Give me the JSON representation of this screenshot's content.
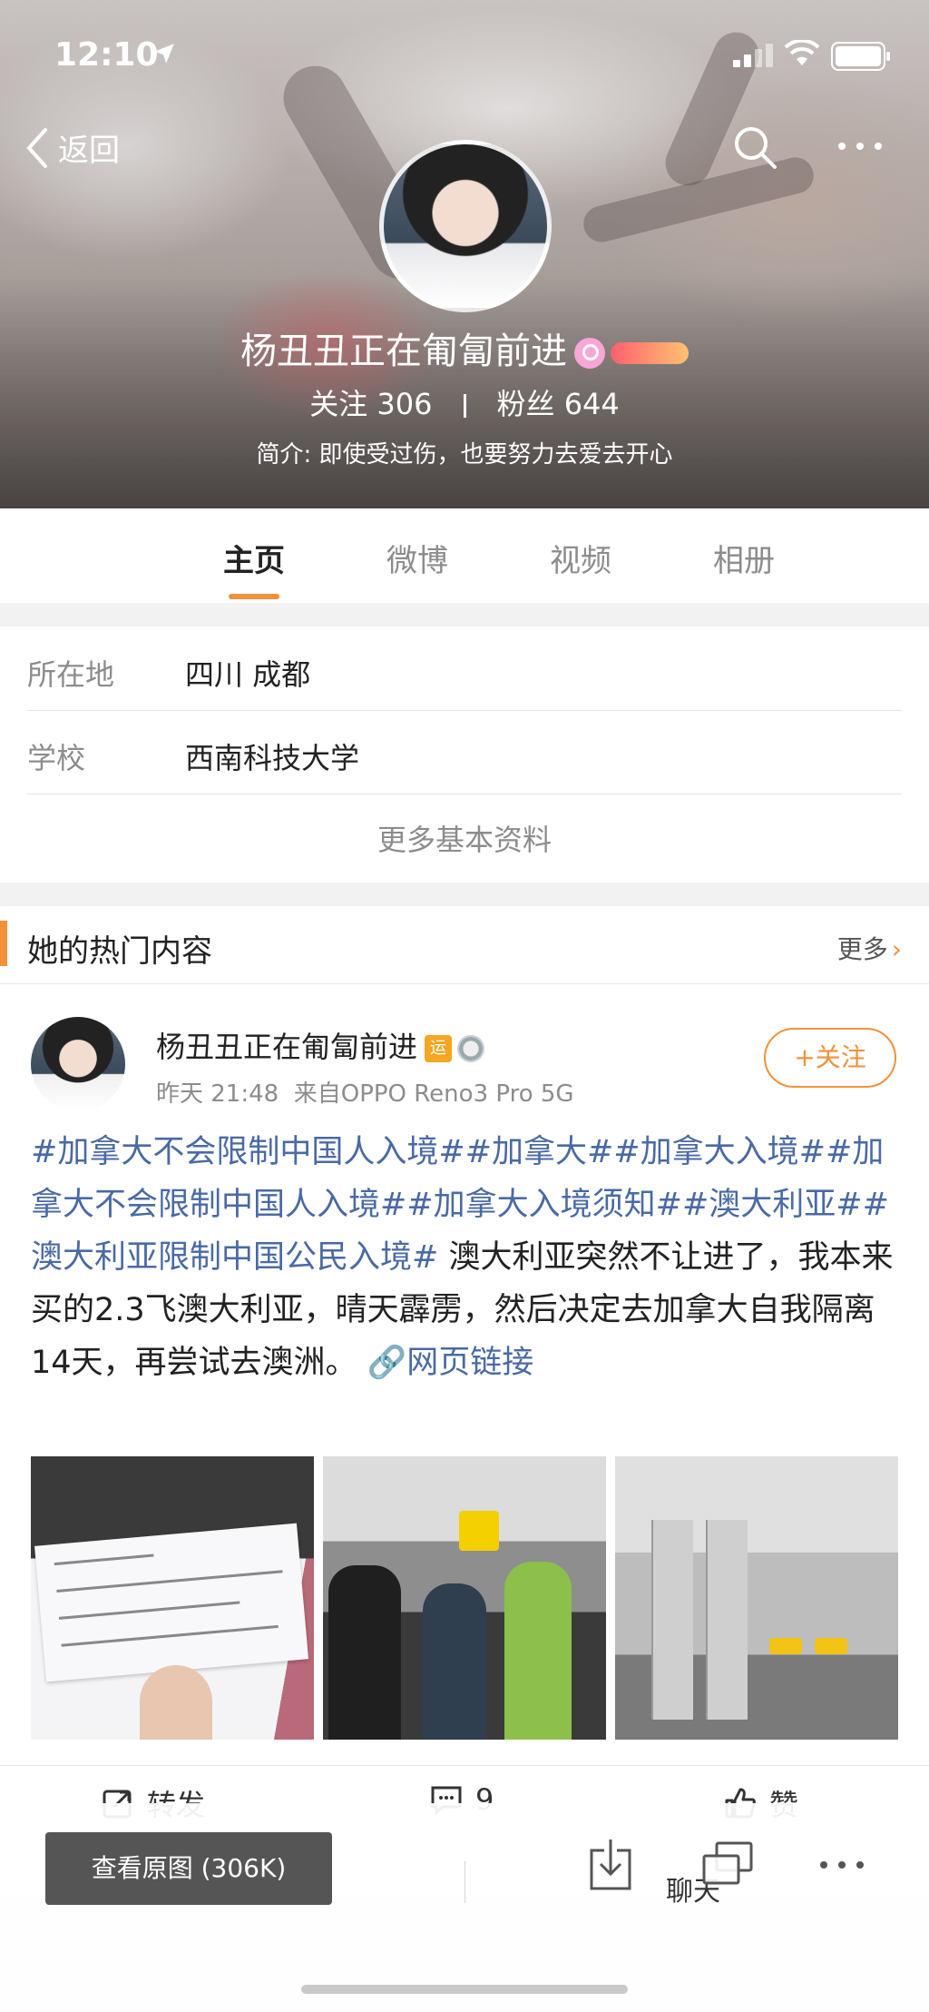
{
  "status_bar": {
    "time": "12:10"
  },
  "nav": {
    "back_label": "返回"
  },
  "profile": {
    "name": "杨丑丑正在匍匐前进",
    "following_label": "关注",
    "following_count": "306",
    "followers_label": "粉丝",
    "followers_count": "644",
    "bio": "简介: 即使受过伤，也要努力去爱去开心"
  },
  "tabs": [
    {
      "label": "主页"
    },
    {
      "label": "微博"
    },
    {
      "label": "视频"
    },
    {
      "label": "相册"
    }
  ],
  "basic_info": {
    "rows": [
      {
        "key": "所在地",
        "value": "四川 成都"
      },
      {
        "key": "学校",
        "value": "西南科技大学"
      }
    ],
    "more_label": "更多基本资料"
  },
  "hot_content": {
    "title": "她的热门内容",
    "more_label": "更多"
  },
  "post": {
    "author": "杨丑丑正在匍匐前进",
    "badge_yun": "运",
    "time": "昨天 21:48",
    "source": "来自OPPO Reno3 Pro 5G",
    "follow_label": "+关注",
    "tags": "#加拿大不会限制中国人入境##加拿大##加拿大入境##加拿大不会限制中国人入境##加拿大入境须知##澳大利亚##澳大利亚限制中国公民入境#",
    "body": " 澳大利亚突然不让进了，我本来买的2.3飞澳大利亚，晴天霹雳，然后决定去加拿大自我隔离14天，再尝试去澳洲。",
    "link_label": "网页链接",
    "repost_label": "转发",
    "comment_count": "9",
    "like_label": "赞"
  },
  "bottom_bar": {
    "view_original_label": "查看原图 (306K)",
    "chat_label": "聊天"
  },
  "colors": {
    "accent": "#f2913a",
    "link": "#4a6aa5"
  }
}
